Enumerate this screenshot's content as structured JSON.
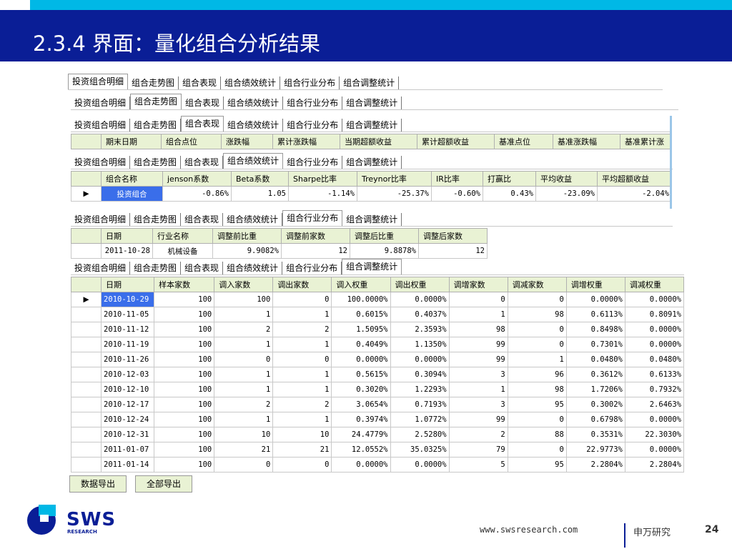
{
  "slide": {
    "title": "2.3.4 界面：量化组合分析结果",
    "footer_url": "www.swsresearch.com",
    "footer_org": "申万研究",
    "page_number": "24",
    "logo_text": "SWS",
    "logo_sub": "RESEARCH",
    "colors": {
      "header_bg": "#0A1E96",
      "accent_bar": "#00B8E6",
      "grid_header": "#E9F2D4",
      "selected_cell": "#3A6EEA"
    }
  },
  "tabs": [
    "投资组合明细",
    "组合走势图",
    "组合表现",
    "组合绩效统计",
    "组合行业分布",
    "组合调整统计"
  ],
  "panel_trend": {
    "headers": [
      "期末日期",
      "组合点位",
      "涨跌幅",
      "累计涨跌幅",
      "当期超额收益",
      "累计超额收益",
      "基准点位",
      "基准涨跌幅",
      "基准累计涨"
    ]
  },
  "panel_perf": {
    "headers": [
      "组合名称",
      "jenson系数",
      "Beta系数",
      "Sharpe比率",
      "Treynor比率",
      "IR比率",
      "打赢比",
      "平均收益",
      "平均超额收益"
    ],
    "row": {
      "indicator": "▶",
      "cells": [
        "投资组合",
        "-0.86%",
        "1.05",
        "-1.14%",
        "-25.37%",
        "-0.60%",
        "0.43%",
        "-23.09%",
        "-2.04%"
      ]
    }
  },
  "panel_industry": {
    "headers": [
      "日期",
      "行业名称",
      "调整前比重",
      "调整前家数",
      "调整后比重",
      "调整后家数"
    ],
    "row": [
      "2011-10-28",
      "机械设备",
      "9.9082%",
      "12",
      "9.8878%",
      "12"
    ]
  },
  "panel_adjust": {
    "headers": [
      "日期",
      "样本家数",
      "调入家数",
      "调出家数",
      "调入权重",
      "调出权重",
      "调增家数",
      "调减家数",
      "调增权重",
      "调减权重"
    ],
    "indicator": "▶",
    "rows": [
      [
        "2010-10-29",
        "100",
        "100",
        "0",
        "100.0000%",
        "0.0000%",
        "0",
        "0",
        "0.0000%",
        "0.0000%"
      ],
      [
        "2010-11-05",
        "100",
        "1",
        "1",
        "0.6015%",
        "0.4037%",
        "1",
        "98",
        "0.6113%",
        "0.8091%"
      ],
      [
        "2010-11-12",
        "100",
        "2",
        "2",
        "1.5095%",
        "2.3593%",
        "98",
        "0",
        "0.8498%",
        "0.0000%"
      ],
      [
        "2010-11-19",
        "100",
        "1",
        "1",
        "0.4049%",
        "1.1350%",
        "99",
        "0",
        "0.7301%",
        "0.0000%"
      ],
      [
        "2010-11-26",
        "100",
        "0",
        "0",
        "0.0000%",
        "0.0000%",
        "99",
        "1",
        "0.0480%",
        "0.0480%"
      ],
      [
        "2010-12-03",
        "100",
        "1",
        "1",
        "0.5615%",
        "0.3094%",
        "3",
        "96",
        "0.3612%",
        "0.6133%"
      ],
      [
        "2010-12-10",
        "100",
        "1",
        "1",
        "0.3020%",
        "1.2293%",
        "1",
        "98",
        "1.7206%",
        "0.7932%"
      ],
      [
        "2010-12-17",
        "100",
        "2",
        "2",
        "3.0654%",
        "0.7193%",
        "3",
        "95",
        "0.3002%",
        "2.6463%"
      ],
      [
        "2010-12-24",
        "100",
        "1",
        "1",
        "0.3974%",
        "1.0772%",
        "99",
        "0",
        "0.6798%",
        "0.0000%"
      ],
      [
        "2010-12-31",
        "100",
        "10",
        "10",
        "24.4779%",
        "2.5280%",
        "2",
        "88",
        "0.3531%",
        "22.3030%"
      ],
      [
        "2011-01-07",
        "100",
        "21",
        "21",
        "12.0552%",
        "35.0325%",
        "79",
        "0",
        "22.9773%",
        "0.0000%"
      ],
      [
        "2011-01-14",
        "100",
        "0",
        "0",
        "0.0000%",
        "0.0000%",
        "5",
        "95",
        "2.2804%",
        "2.2804%"
      ]
    ]
  },
  "buttons": {
    "export_data": "数据导出",
    "export_all": "全部导出"
  }
}
